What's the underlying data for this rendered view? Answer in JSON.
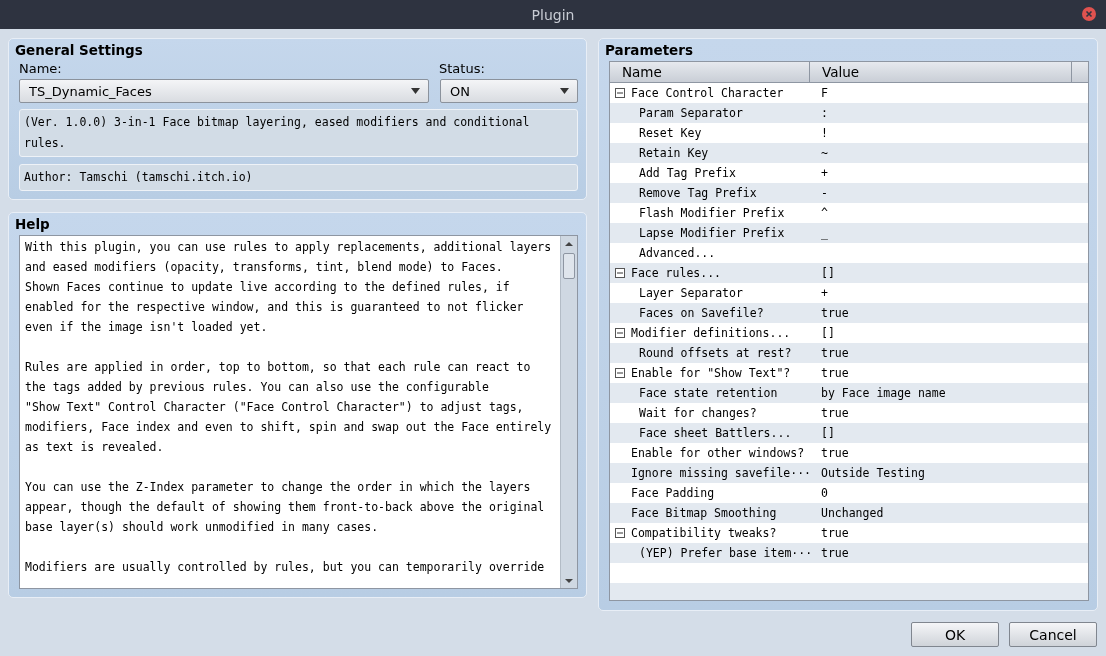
{
  "window": {
    "title": "Plugin"
  },
  "general": {
    "title": "General Settings",
    "name_label": "Name:",
    "name_value": "TS_Dynamic_Faces",
    "status_label": "Status:",
    "status_value": "ON",
    "description": "(Ver. 1.0.0) 3-in-1 Face bitmap layering, eased modifiers and conditional rules.",
    "author": "Author: Tamschi (tamschi.itch.io)"
  },
  "help": {
    "title": "Help",
    "paragraphs": [
      "With this plugin, you can use rules to apply replacements, additional layers\nand eased modifiers (opacity, transforms, tint, blend mode) to Faces.\nShown Faces continue to update live according to the defined rules, if\nenabled for the respective window, and this is guaranteed to not flicker\neven if the image isn't loaded yet.",
      "Rules are applied in order, top to bottom, so that each rule can react to\nthe tags added by previous rules. You can also use the configurable\n\"Show Text\" Control Character (\"Face Control Character\") to adjust tags,\nmodifiers, Face index and even to shift, spin and swap out the Face entirely\nas text is revealed.",
      "You can use the Z-Index parameter to change the order in which the layers\nappear, though the default of showing them front-to-back above the original\nbase layer(s) should work unmodified in many cases.",
      "Modifiers are usually controlled by rules, but you can temporarily override"
    ]
  },
  "parameters": {
    "title": "Parameters",
    "columns": [
      "Name",
      "Value"
    ],
    "rows": [
      {
        "name": "Face Control Character",
        "value": "F",
        "expanded": true,
        "children": [
          {
            "name": "Param Separator",
            "value": ":"
          },
          {
            "name": "Reset Key",
            "value": "!"
          },
          {
            "name": "Retain Key",
            "value": "~"
          },
          {
            "name": "Add Tag Prefix",
            "value": "+"
          },
          {
            "name": "Remove Tag Prefix",
            "value": "-"
          },
          {
            "name": "Flash Modifier Prefix",
            "value": "^"
          },
          {
            "name": "Lapse Modifier Prefix",
            "value": "_"
          },
          {
            "name": "Advanced..."
          }
        ]
      },
      {
        "name": "Face rules...",
        "value": "[]",
        "expanded": true,
        "children": [
          {
            "name": "Layer Separator",
            "value": "+"
          },
          {
            "name": "Faces on Savefile?",
            "value": "true"
          }
        ]
      },
      {
        "name": "Modifier definitions...",
        "value": "[]",
        "expanded": true,
        "children": [
          {
            "name": "Round offsets at rest?",
            "value": "true"
          }
        ]
      },
      {
        "name": "Enable for \"Show Text\"?",
        "value": "true",
        "expanded": true,
        "children": [
          {
            "name": "Face state retention",
            "value": "by Face image name"
          },
          {
            "name": "Wait for changes?",
            "value": "true"
          },
          {
            "name": "Face sheet Battlers...",
            "value": "[]"
          }
        ]
      },
      {
        "name": "Enable for other windows?",
        "value": "true"
      },
      {
        "name": "Ignore missing savefile···",
        "value": "Outside Testing"
      },
      {
        "name": "Face Padding",
        "value": "0"
      },
      {
        "name": "Face Bitmap Smoothing",
        "value": "Unchanged"
      },
      {
        "name": "Compatibility tweaks?",
        "value": "true",
        "expanded": true,
        "children": [
          {
            "name": "(YEP) Prefer base item···",
            "value": "true"
          }
        ]
      }
    ]
  },
  "buttons": [
    "OK",
    "Cancel"
  ]
}
